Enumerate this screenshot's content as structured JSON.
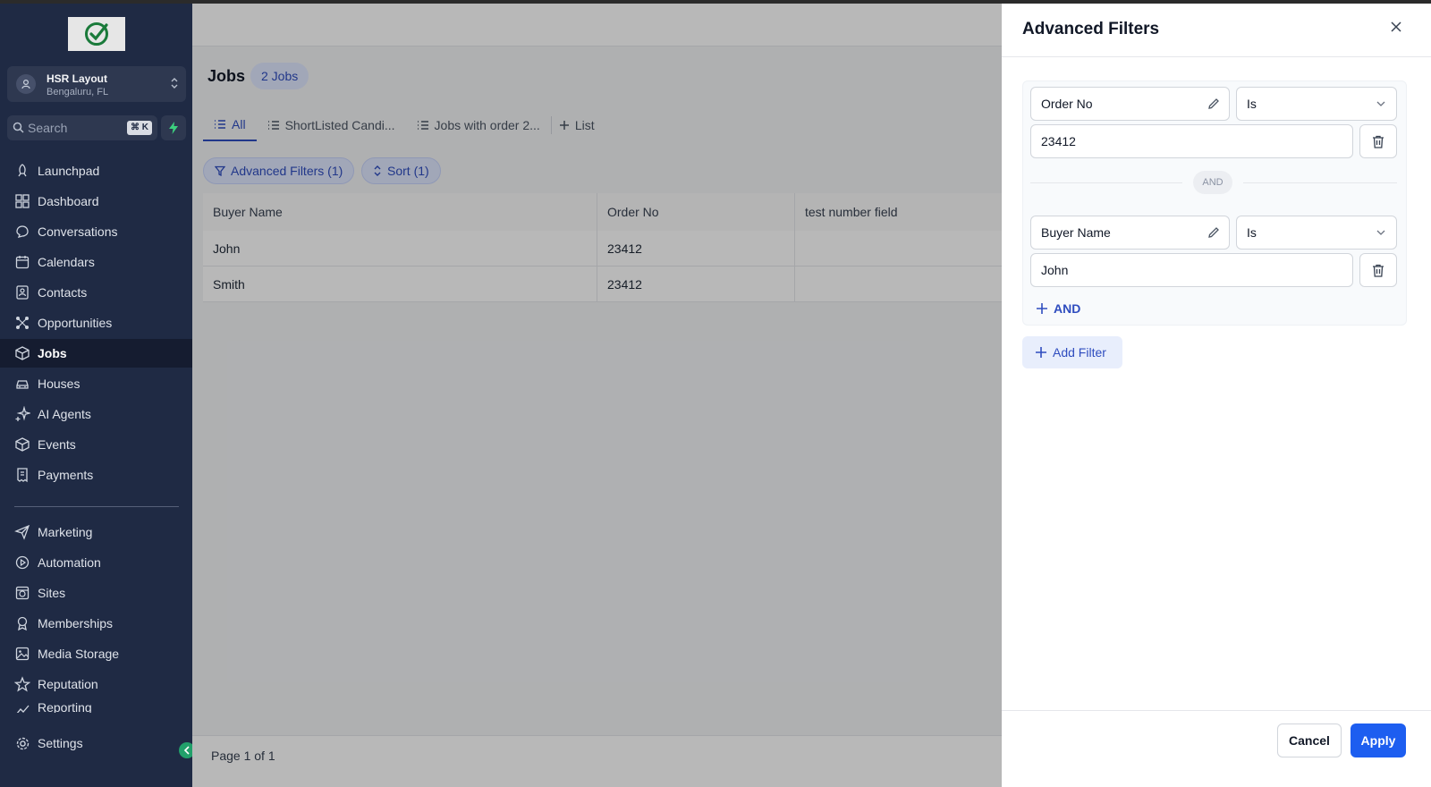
{
  "colors": {
    "sidebar_bg": "#1f2a44",
    "accent": "#2f4dbf",
    "apply_button": "#1d5ef0",
    "logo_check": "#1a7a3a",
    "collapse_button": "#22a06b"
  },
  "sidebar": {
    "location_name": "HSR Layout",
    "location_sub": "Bengaluru, FL",
    "search_placeholder": "Search",
    "search_shortcut": "⌘ K",
    "items": [
      {
        "label": "Launchpad",
        "icon": "rocket-icon"
      },
      {
        "label": "Dashboard",
        "icon": "grid-icon"
      },
      {
        "label": "Conversations",
        "icon": "chat-icon"
      },
      {
        "label": "Calendars",
        "icon": "calendar-icon"
      },
      {
        "label": "Contacts",
        "icon": "contacts-icon"
      },
      {
        "label": "Opportunities",
        "icon": "pipeline-icon"
      },
      {
        "label": "Jobs",
        "icon": "cube-icon",
        "active": true
      },
      {
        "label": "Houses",
        "icon": "car-icon"
      },
      {
        "label": "AI Agents",
        "icon": "sparkle-icon"
      },
      {
        "label": "Events",
        "icon": "cube-icon"
      },
      {
        "label": "Payments",
        "icon": "receipt-icon"
      }
    ],
    "items2": [
      {
        "label": "Marketing",
        "icon": "send-icon"
      },
      {
        "label": "Automation",
        "icon": "automation-icon"
      },
      {
        "label": "Sites",
        "icon": "globe-icon"
      },
      {
        "label": "Memberships",
        "icon": "badge-icon"
      },
      {
        "label": "Media Storage",
        "icon": "image-icon"
      },
      {
        "label": "Reputation",
        "icon": "star-icon"
      },
      {
        "label": "Reporting",
        "icon": "chart-icon"
      }
    ],
    "settings_label": "Settings"
  },
  "main": {
    "title": "Jobs",
    "count_badge": "2 Jobs",
    "tabs": [
      {
        "label": "All",
        "active": true
      },
      {
        "label": "ShortListed Candi..."
      },
      {
        "label": "Jobs with order 2..."
      },
      {
        "label": "List"
      }
    ],
    "filters_chip": "Advanced Filters (1)",
    "sort_chip": "Sort (1)",
    "table": {
      "columns": [
        "Buyer Name",
        "Order No",
        "test number field"
      ],
      "rows": [
        [
          "John",
          "23412",
          ""
        ],
        [
          "Smith",
          "23412",
          ""
        ]
      ]
    },
    "pagination": "Page 1 of 1"
  },
  "drawer": {
    "title": "Advanced Filters",
    "filters": [
      {
        "field": "Order No",
        "operator": "Is",
        "value": "23412"
      },
      {
        "field": "Buyer Name",
        "operator": "Is",
        "value": "John"
      }
    ],
    "joiner": "AND",
    "add_and": "AND",
    "add_filter": "Add Filter",
    "cancel": "Cancel",
    "apply": "Apply"
  }
}
